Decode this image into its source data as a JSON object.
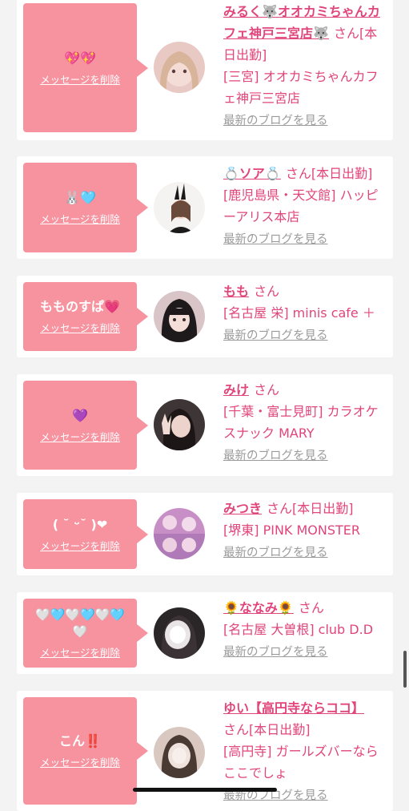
{
  "delete_label": "メッセージを削除",
  "blog_label": "最新のブログを見る",
  "san_label": "さん",
  "colors": {
    "accent": "#e0457b",
    "bubble": "#f7929f",
    "link_gray": "#9b9b9b"
  },
  "cards": [
    {
      "message": "💖💖",
      "name": "みるく🐺オオカミちゃんカフェ神戸三宮店🐺",
      "status": "[本日出勤]",
      "shop": "[三宮] オオカミちゃんカフェ神戸三宮店",
      "avatar": "blonde-girl-photo"
    },
    {
      "message": "🐰🩵",
      "name": "💍ソア💍",
      "status": "[本日出勤]",
      "shop": "[鹿児島県・天文館] ハッピーアリス本店",
      "avatar": "bunny-ears-photo"
    },
    {
      "message": "もものすぱ💗",
      "name": "もも",
      "status": "",
      "shop": "[名古屋 栄] minis cafe ＋",
      "avatar": "dark-hair-photo"
    },
    {
      "message": "💜",
      "name": "みけ",
      "status": "",
      "shop": "[千葉・富士見町] カラオケスナック MARY",
      "avatar": "peace-sign-photo"
    },
    {
      "message": "( ˘ ᵕ˘ )❤",
      "name": "みつき",
      "status": "[本日出勤]",
      "shop": "[堺東] PINK MONSTER",
      "avatar": "pink-collage-photo"
    },
    {
      "message": "🤍🩵🤍🩵🤍🩵🤍",
      "name": "🌻ななみ🌻",
      "status": "",
      "shop": "[名古屋 大曽根] club D.D",
      "avatar": "blurred-face-photo"
    },
    {
      "message": "こん‼️",
      "name": "ゆい【高円寺ならココ】",
      "status": "[本日出勤]",
      "shop": "[高円寺] ガールズバーならここでしょ",
      "avatar": "blurred-face-photo"
    }
  ]
}
